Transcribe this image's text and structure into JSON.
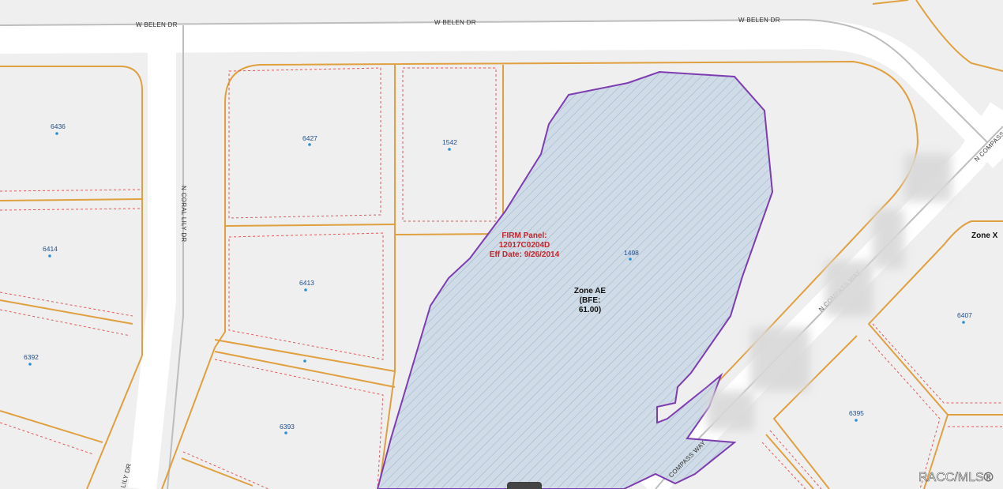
{
  "roads": {
    "belen_1": "W BELEN DR",
    "belen_2": "W BELEN DR",
    "belen_3": "W BELEN DR",
    "coral_lily": "N CORAL LILY DR",
    "lily_bottom": "LILY DR",
    "compass_top": "N COMPASS W",
    "compass_mid": "N COMPASS WAY",
    "compass_bottom": "COMPASS WAY"
  },
  "parcels": [
    "6436",
    "6427",
    "1542",
    "6414",
    "6413",
    "1498",
    "6392",
    "6393",
    "6407",
    "6395"
  ],
  "zones": {
    "ae_line1": "Zone AE",
    "ae_line2": "(BFE:",
    "ae_line3": "61.00)",
    "x": "Zone X"
  },
  "firm": {
    "line1": "FIRM Panel:",
    "line2": "12017C0204D",
    "line3": "Eff Date: 9/26/2014"
  },
  "watermark": "RACC/MLS®",
  "colors": {
    "parcel_line": "#e0a040",
    "lot_dash": "#e05a5a",
    "flood_outline": "#7d3cb0",
    "flood_fill": "#cfdbe6",
    "firm_text": "#c0272d"
  }
}
